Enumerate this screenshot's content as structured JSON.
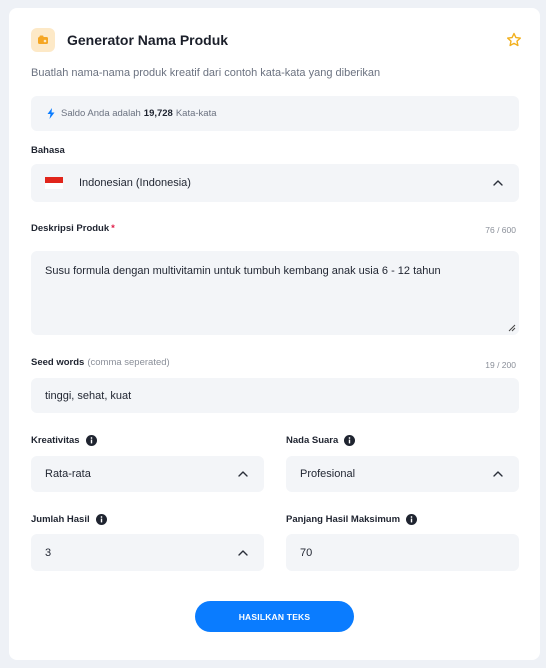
{
  "header": {
    "title": "Generator Nama Produk",
    "subtitle": "Buatlah nama-nama produk kreatif dari contoh kata-kata yang diberikan"
  },
  "balance": {
    "prefix": "Saldo Anda adalah",
    "amount": "19,728",
    "suffix": "Kata-kata"
  },
  "language": {
    "label": "Bahasa",
    "value": "Indonesian (Indonesia)"
  },
  "description": {
    "label": "Deskripsi Produk",
    "required_mark": "*",
    "counter": "76 / 600",
    "value": "Susu formula dengan multivitamin untuk tumbuh kembang anak usia 6 - 12 tahun"
  },
  "seed_words": {
    "label": "Seed words",
    "hint": "(comma seperated)",
    "counter": "19 / 200",
    "value": "tinggi, sehat, kuat"
  },
  "creativity": {
    "label": "Kreativitas",
    "value": "Rata-rata"
  },
  "tone": {
    "label": "Nada Suara",
    "value": "Profesional"
  },
  "result_count": {
    "label": "Jumlah Hasil",
    "value": "3"
  },
  "max_length": {
    "label": "Panjang Hasil Maksimum",
    "value": "70"
  },
  "submit": {
    "label": "HASILKAN TEKS"
  },
  "colors": {
    "accent": "#0a7cff",
    "field_bg": "#f3f5f8",
    "star": "#f2b01e",
    "required": "#e11d48"
  }
}
